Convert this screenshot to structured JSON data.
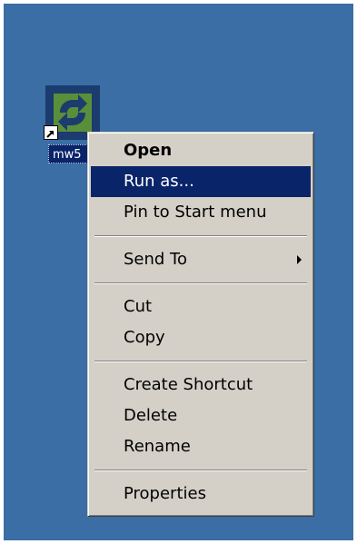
{
  "desktop": {
    "background_color": "#3a6ea5",
    "icon": {
      "label": "mw5",
      "icon_name": "app-shortcut-icon",
      "overlay_icon": "shortcut-arrow-icon"
    }
  },
  "context_menu": {
    "selected_index": 1,
    "highlight_color": "#0a246a",
    "items": [
      {
        "label": "Open",
        "default": true
      },
      {
        "label": "Run as...",
        "selected": true
      },
      {
        "label": "Pin to Start menu"
      },
      {
        "label": "Send To",
        "submenu": true
      },
      {
        "label": "Cut"
      },
      {
        "label": "Copy"
      },
      {
        "label": "Create Shortcut"
      },
      {
        "label": "Delete"
      },
      {
        "label": "Rename"
      },
      {
        "label": "Properties"
      }
    ]
  }
}
